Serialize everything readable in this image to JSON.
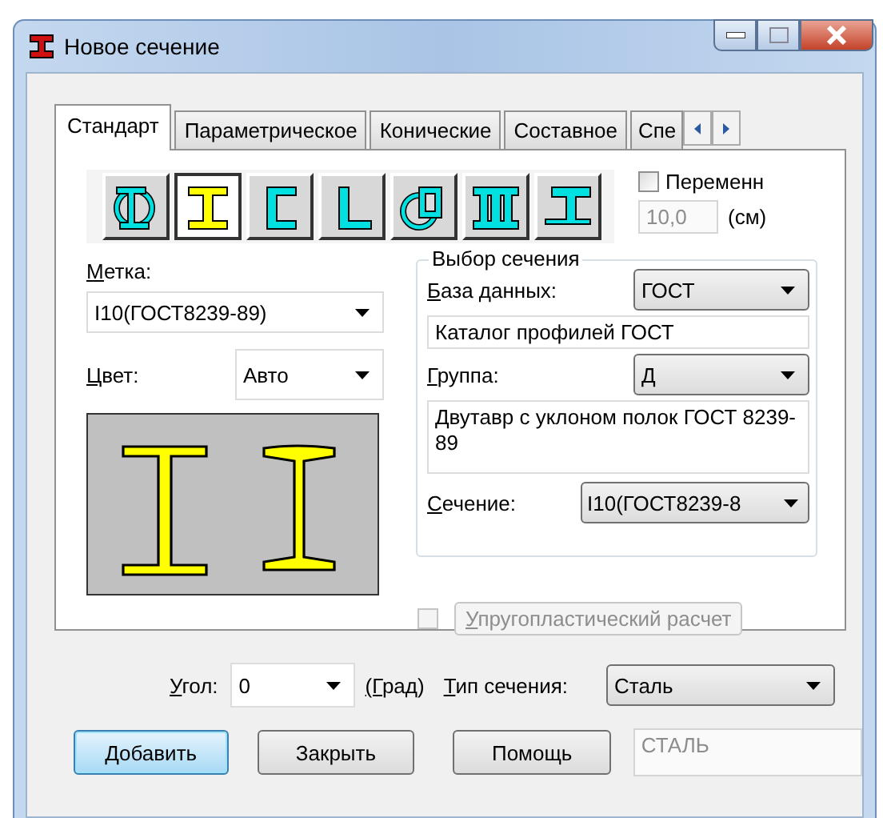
{
  "window": {
    "title": "Новое сечение"
  },
  "tabs": [
    {
      "label": "Стандарт",
      "selected": true
    },
    {
      "label": "Параметрическое",
      "selected": false
    },
    {
      "label": "Конические",
      "selected": false
    },
    {
      "label": "Составное",
      "selected": false
    },
    {
      "label": "Спе",
      "selected": false
    }
  ],
  "section_kinds": [
    {
      "kind": "composite",
      "selected": false
    },
    {
      "kind": "i-beam",
      "selected": true
    },
    {
      "kind": "channel",
      "selected": false
    },
    {
      "kind": "angle",
      "selected": false
    },
    {
      "kind": "tube",
      "selected": false
    },
    {
      "kind": "double-i",
      "selected": false
    },
    {
      "kind": "tee",
      "selected": false
    }
  ],
  "variable": {
    "label": "Переменн",
    "checked": false,
    "value": "10,0",
    "unit": "(см)",
    "disabled": true
  },
  "mark": {
    "label": "Метка:",
    "value": "I10(ГОСТ8239-89)"
  },
  "color": {
    "label": "Цвет:",
    "value": "Авто"
  },
  "selection": {
    "title": "Выбор сечения",
    "database": {
      "label": "База данных:",
      "value": "ГОСТ"
    },
    "catalog": "Каталог профилей ГОСТ",
    "group": {
      "label": "Группа:",
      "value": "Д"
    },
    "description": "Двутавр с уклоном полок ГОСТ 8239-89",
    "section": {
      "label": "Сечение:",
      "value": "I10(ГОСТ8239-8"
    }
  },
  "elastoplastic": {
    "label": "Упругопластический расчет",
    "checked": false,
    "disabled": true
  },
  "angle": {
    "label": "Угол:",
    "value": "0",
    "unit": "(Град)"
  },
  "section_type": {
    "label": "Тип сечения:",
    "value": "Сталь"
  },
  "buttons": [
    {
      "label": "Добавить",
      "default": true
    },
    {
      "label": "Закрыть",
      "default": false
    },
    {
      "label": "Помощь",
      "default": false
    }
  ],
  "material": {
    "value": "СТАЛЬ",
    "disabled": true
  }
}
